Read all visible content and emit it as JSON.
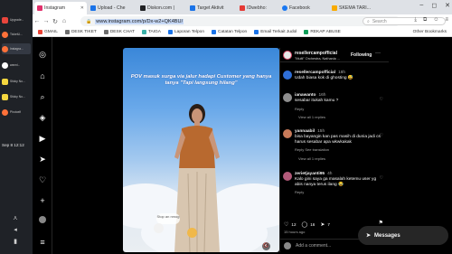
{
  "os_panel": {
    "items": [
      {
        "label": "Upgrade...",
        "color": "#e8453c"
      },
      {
        "label": "TicketU...",
        "color": "#ff7139"
      },
      {
        "label": "Instagra...",
        "color": "#ff7139"
      },
      {
        "label": "wanni...",
        "color": "#ffffff"
      },
      {
        "label": "Sticky No...",
        "color": "#f6d73f"
      },
      {
        "label": "Sticky No...",
        "color": "#f6d73f"
      },
      {
        "label": "Photoelf",
        "color": "#ff7139"
      }
    ],
    "clock": "Sep 8  12:12"
  },
  "browser": {
    "tabs": [
      {
        "label": "Instagram",
        "favicon": "instagram-icon",
        "color": "#e1306c"
      },
      {
        "label": "Upload - Che",
        "favicon": "upload-icon",
        "color": "#1a73e8"
      },
      {
        "label": "Diskon.com |",
        "favicon": "diskon-icon",
        "color": "#202124"
      },
      {
        "label": "Target Aktivit",
        "favicon": "target-icon",
        "color": "#1a73e8"
      },
      {
        "label": "IDwebho:",
        "favicon": "idwebhost-icon",
        "color": "#e53935"
      },
      {
        "label": "Facebook",
        "favicon": "facebook-icon",
        "color": "#1877f2"
      },
      {
        "label": "SKEMA TARI...",
        "favicon": "skema-icon",
        "color": "#f9ab00"
      }
    ],
    "url": "www.instagram.com/p/Dx-w2+QK4BU/",
    "search_placeholder": "Search",
    "bookmarks": [
      {
        "label": "GMAIL",
        "color": "#ea4335"
      },
      {
        "label": "DESK TIKET",
        "color": "#6d6d6d"
      },
      {
        "label": "DESK CHAT",
        "color": "#6d6d6d"
      },
      {
        "label": "TAIGA",
        "color": "#3ab0a8"
      },
      {
        "label": "Laporan Telpon",
        "color": "#1a73e8"
      },
      {
        "label": "Catatan Telpon",
        "color": "#1a73e8"
      },
      {
        "label": "Email Terkait Judol",
        "color": "#1a73e8"
      },
      {
        "label": "REKAP ABUSE",
        "color": "#0f9d58"
      }
    ],
    "other_bookmarks": "Other Bookmarks"
  },
  "reel": {
    "caption": "POV masuk surga via jalur hadapi Customer yang hanya tanya \"Tapi langsung hilang\"",
    "stitch_text": "Stop an nmog"
  },
  "post": {
    "username": "resellercampofficial",
    "subtitle": "\"Multi\" Orchestra, Nathanla ...",
    "follow": "Following",
    "comments": [
      {
        "user": "resellercampofficial",
        "time": "18h",
        "text": "Udah biasa kok di ghosting 😅",
        "meta": "",
        "replies": "",
        "avatar": "#2f6fd8"
      },
      {
        "user": "ianawanto",
        "time": "16h",
        "text": "sesabar itukah kamu ?",
        "meta": "Reply",
        "replies": "View all 1 replies",
        "avatar": "#8e8e8e"
      },
      {
        "user": "yannaabil",
        "time": "15h",
        "text": "bisa bayangin kan pas masih di dunia jadi cs harus sesabar apa wkwkakak",
        "meta": "Reply   See translation",
        "replies": "View all 1 replies",
        "avatar": "#c97b5a"
      },
      {
        "user": "zerietjayanti95",
        "time": "4h",
        "text": "Kalo gini saya ga masalah ketemu user yg abis nanya terus ilang 😂",
        "meta": "Reply",
        "replies": "",
        "avatar": "#b35a7a"
      }
    ],
    "likes": "12",
    "comment_count": "16",
    "shares": "7",
    "posted": "15 hours ago",
    "add_comment": "Add a comment..."
  },
  "messages": "Messages"
}
